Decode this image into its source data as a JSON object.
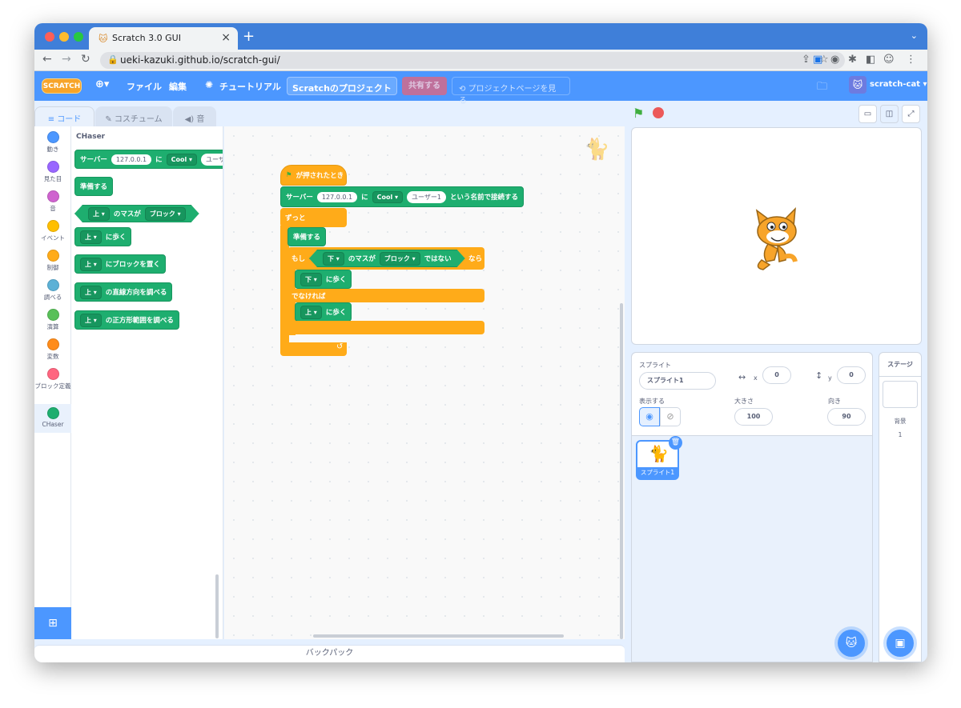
{
  "browser": {
    "tab_title": "Scratch 3.0 GUI",
    "tab_favicon": "🐱",
    "url": "ueki-kazuki.github.io/scratch-gui/"
  },
  "menubar": {
    "logo": "SCRATCH",
    "file": "ファイル",
    "edit": "編集",
    "tutorials": "チュートリアル",
    "project_title": "Scratchのプロジェクト",
    "share": "共有する",
    "see_project_page": "プロジェクトページを見る",
    "username": "scratch-cat"
  },
  "editor_tabs": {
    "code": "コード",
    "costumes": "コスチューム",
    "sounds": "音"
  },
  "categories": [
    {
      "label": "動き",
      "color": "#4c97ff"
    },
    {
      "label": "見た目",
      "color": "#9966ff"
    },
    {
      "label": "音",
      "color": "#cf63cf"
    },
    {
      "label": "イベント",
      "color": "#ffbf00"
    },
    {
      "label": "制御",
      "color": "#ffab19"
    },
    {
      "label": "調べる",
      "color": "#5cb1d6"
    },
    {
      "label": "演算",
      "color": "#59c059"
    },
    {
      "label": "変数",
      "color": "#ff8c1a"
    },
    {
      "label": "ブロック定義",
      "color": "#ff6680"
    },
    {
      "label": "CHaser",
      "color": "#1eae6f"
    }
  ],
  "palette": {
    "heading": "CHaser",
    "connect": {
      "server": "サーバー",
      "ip": "127.0.0.1",
      "ni": "に",
      "team": "Cool",
      "user": "ユーザー"
    },
    "ready": "準備する",
    "cond": {
      "dir": "上",
      "mid": "のマスが",
      "kind": "ブロック"
    },
    "walk": {
      "dir": "上",
      "text": "に歩く"
    },
    "put": {
      "dir": "上",
      "text": "にブロックを置く"
    },
    "look": {
      "dir": "上",
      "text": "の直線方向を調べる"
    },
    "search": {
      "dir": "上",
      "text": "の正方形範囲を調べる"
    }
  },
  "script": {
    "hat": "が押されたとき",
    "connect": {
      "server": "サーバー",
      "ip": "127.0.0.1",
      "ni": "に",
      "team": "Cool",
      "user": "ユーザー1",
      "suffix": "という名前で接続する"
    },
    "forever": "ずっと",
    "ready": "準備する",
    "if_label": "もし",
    "cond_dir": "下",
    "cond_mid": "のマスが",
    "cond_kind": "ブロック",
    "not_label": "ではない",
    "then_label": "なら",
    "walk_down": {
      "dir": "下",
      "text": "に歩く"
    },
    "else_label": "でなければ",
    "walk_up": {
      "dir": "上",
      "text": "に歩く"
    }
  },
  "backpack": "バックパック",
  "sprite_info": {
    "sprite_label": "スプライト",
    "sprite_name": "スプライト1",
    "x_label": "x",
    "x": "0",
    "y_label": "y",
    "y": "0",
    "show_label": "表示する",
    "size_label": "大きさ",
    "size": "100",
    "direction_label": "向き",
    "direction": "90"
  },
  "sprite_thumb": "スプライト1",
  "stage_pane": {
    "title": "ステージ",
    "backdrops_label": "背景",
    "backdrops_count": "1"
  },
  "colors": {
    "scratch_blue": "#4c97ff",
    "chaser_green": "#1eae6f",
    "control_orange": "#ffab19"
  }
}
